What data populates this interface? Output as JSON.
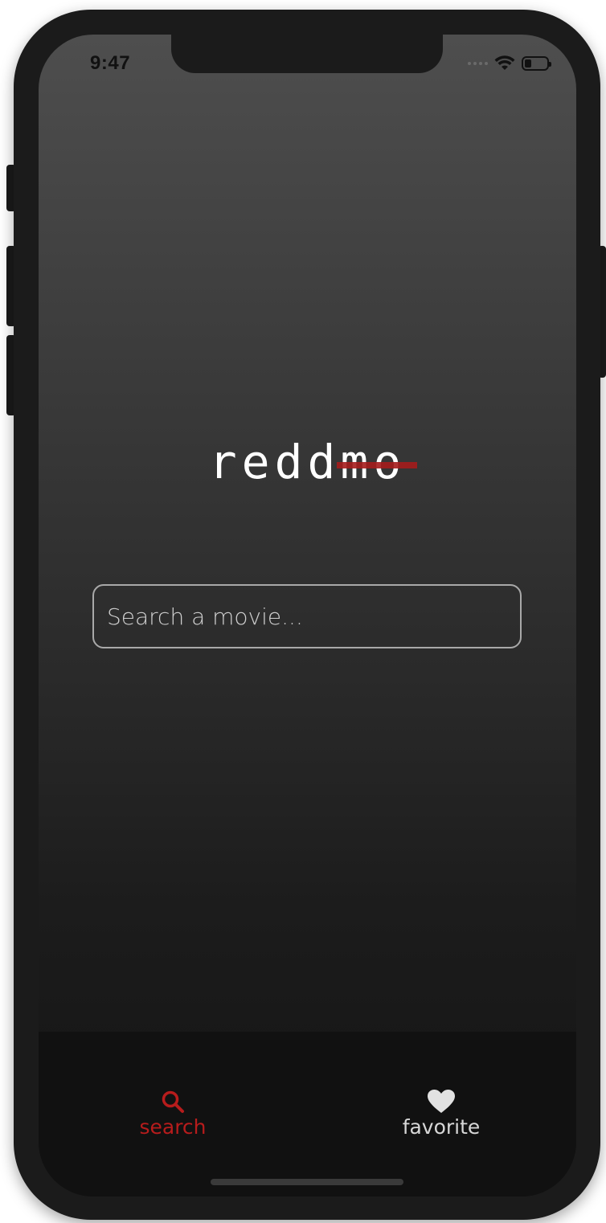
{
  "status_bar": {
    "time": "9:47"
  },
  "app": {
    "logo_plain": "redd",
    "logo_struck": "mo"
  },
  "search": {
    "placeholder": "Search a movie...",
    "value": ""
  },
  "tab_bar": {
    "tabs": [
      {
        "label": "search",
        "icon": "search-icon",
        "active": true
      },
      {
        "label": "favorite",
        "icon": "heart-icon",
        "active": false
      }
    ]
  },
  "colors": {
    "accent": "#b71c1c",
    "inactive_tab": "#d7d7d7",
    "tab_bar_bg": "#111111",
    "text_primary": "#ffffff"
  },
  "battery_level": 0.3
}
